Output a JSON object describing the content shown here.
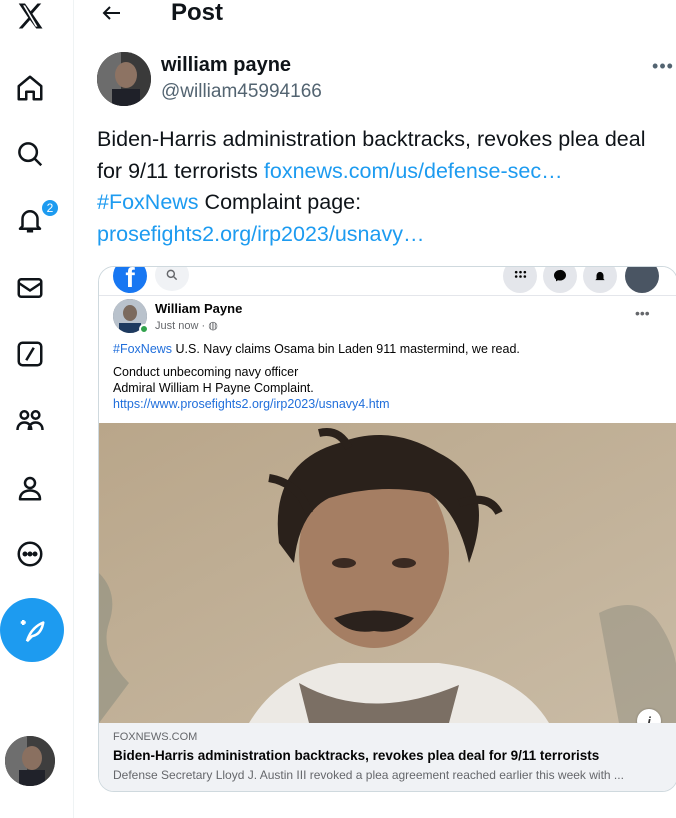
{
  "sidebar": {
    "notifications_badge": "2",
    "icons": [
      "x-logo-icon",
      "home-icon",
      "search-icon",
      "bell-icon",
      "mail-icon",
      "grok-icon",
      "communities-icon",
      "profile-icon",
      "more-circle-icon",
      "post-compose-icon"
    ]
  },
  "header": {
    "title": "Post"
  },
  "post": {
    "author_name": "william payne",
    "author_handle": "@william45994166",
    "more_glyph": "•••",
    "text_1": "Biden-Harris administration backtracks, revokes plea deal for 9/11 terrorists ",
    "link_1": "foxnews.com/us/defense-sec…",
    "hashtag": "#FoxNews",
    "text_2": " Complaint page: ",
    "link_2": "prosefights2.org/irp2023/usnavy…"
  },
  "embedded": {
    "fb_logo": "f",
    "fb_author": "William Payne",
    "fb_time": "Just now · ",
    "fb_dots": "•••",
    "fb_hashtag": "#FoxNews",
    "fb_line_1": " U.S. Navy claims Osama bin Laden 911 mastermind, we read.",
    "fb_line_2": "Conduct unbecoming navy officer",
    "fb_line_3": "Admiral William H Payne Complaint.",
    "fb_link": "https://www.prosefights2.org/irp2023/usnavy4.htm",
    "info_glyph": "i",
    "preview_domain": "FOXNEWS.COM",
    "preview_title": "Biden-Harris administration backtracks, revokes plea deal for 9/11 terrorists",
    "preview_desc": "Defense Secretary Lloyd J. Austin III revoked a plea agreement reached earlier this week with ..."
  },
  "colors": {
    "accent": "#1d9bf0",
    "facebook": "#1877f2",
    "text": "#0f1419",
    "muted": "#536471"
  }
}
